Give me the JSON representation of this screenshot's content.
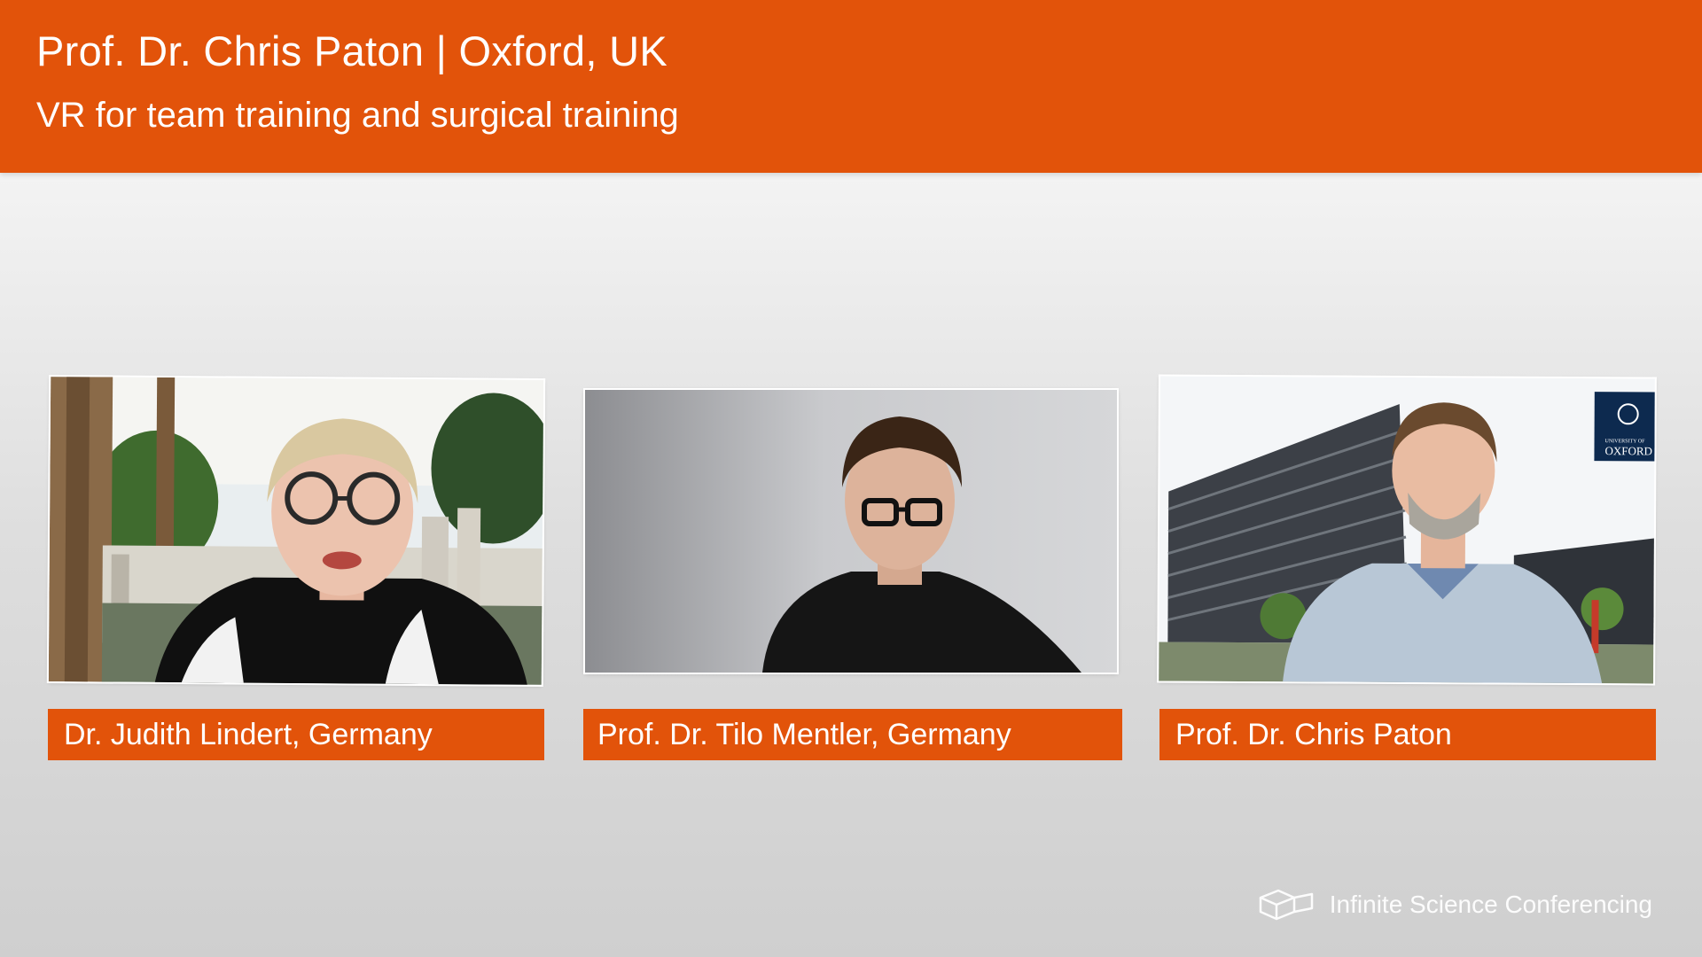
{
  "header": {
    "title": "Prof. Dr. Chris Paton | Oxford, UK",
    "subtitle": "VR for team training and surgical training",
    "background_color": "#e2530a"
  },
  "participants": [
    {
      "name_label": "Dr. Judith Lindert, Germany"
    },
    {
      "name_label": "Prof. Dr. Tilo Mentler, Germany"
    },
    {
      "name_label": "Prof. Dr. Chris Paton",
      "backdrop_logo": {
        "line1": "UNIVERSITY OF",
        "line2": "OXFORD"
      }
    }
  ],
  "branding": {
    "text": "Infinite Science Conferencing",
    "icon": "cube-outline-icon"
  }
}
